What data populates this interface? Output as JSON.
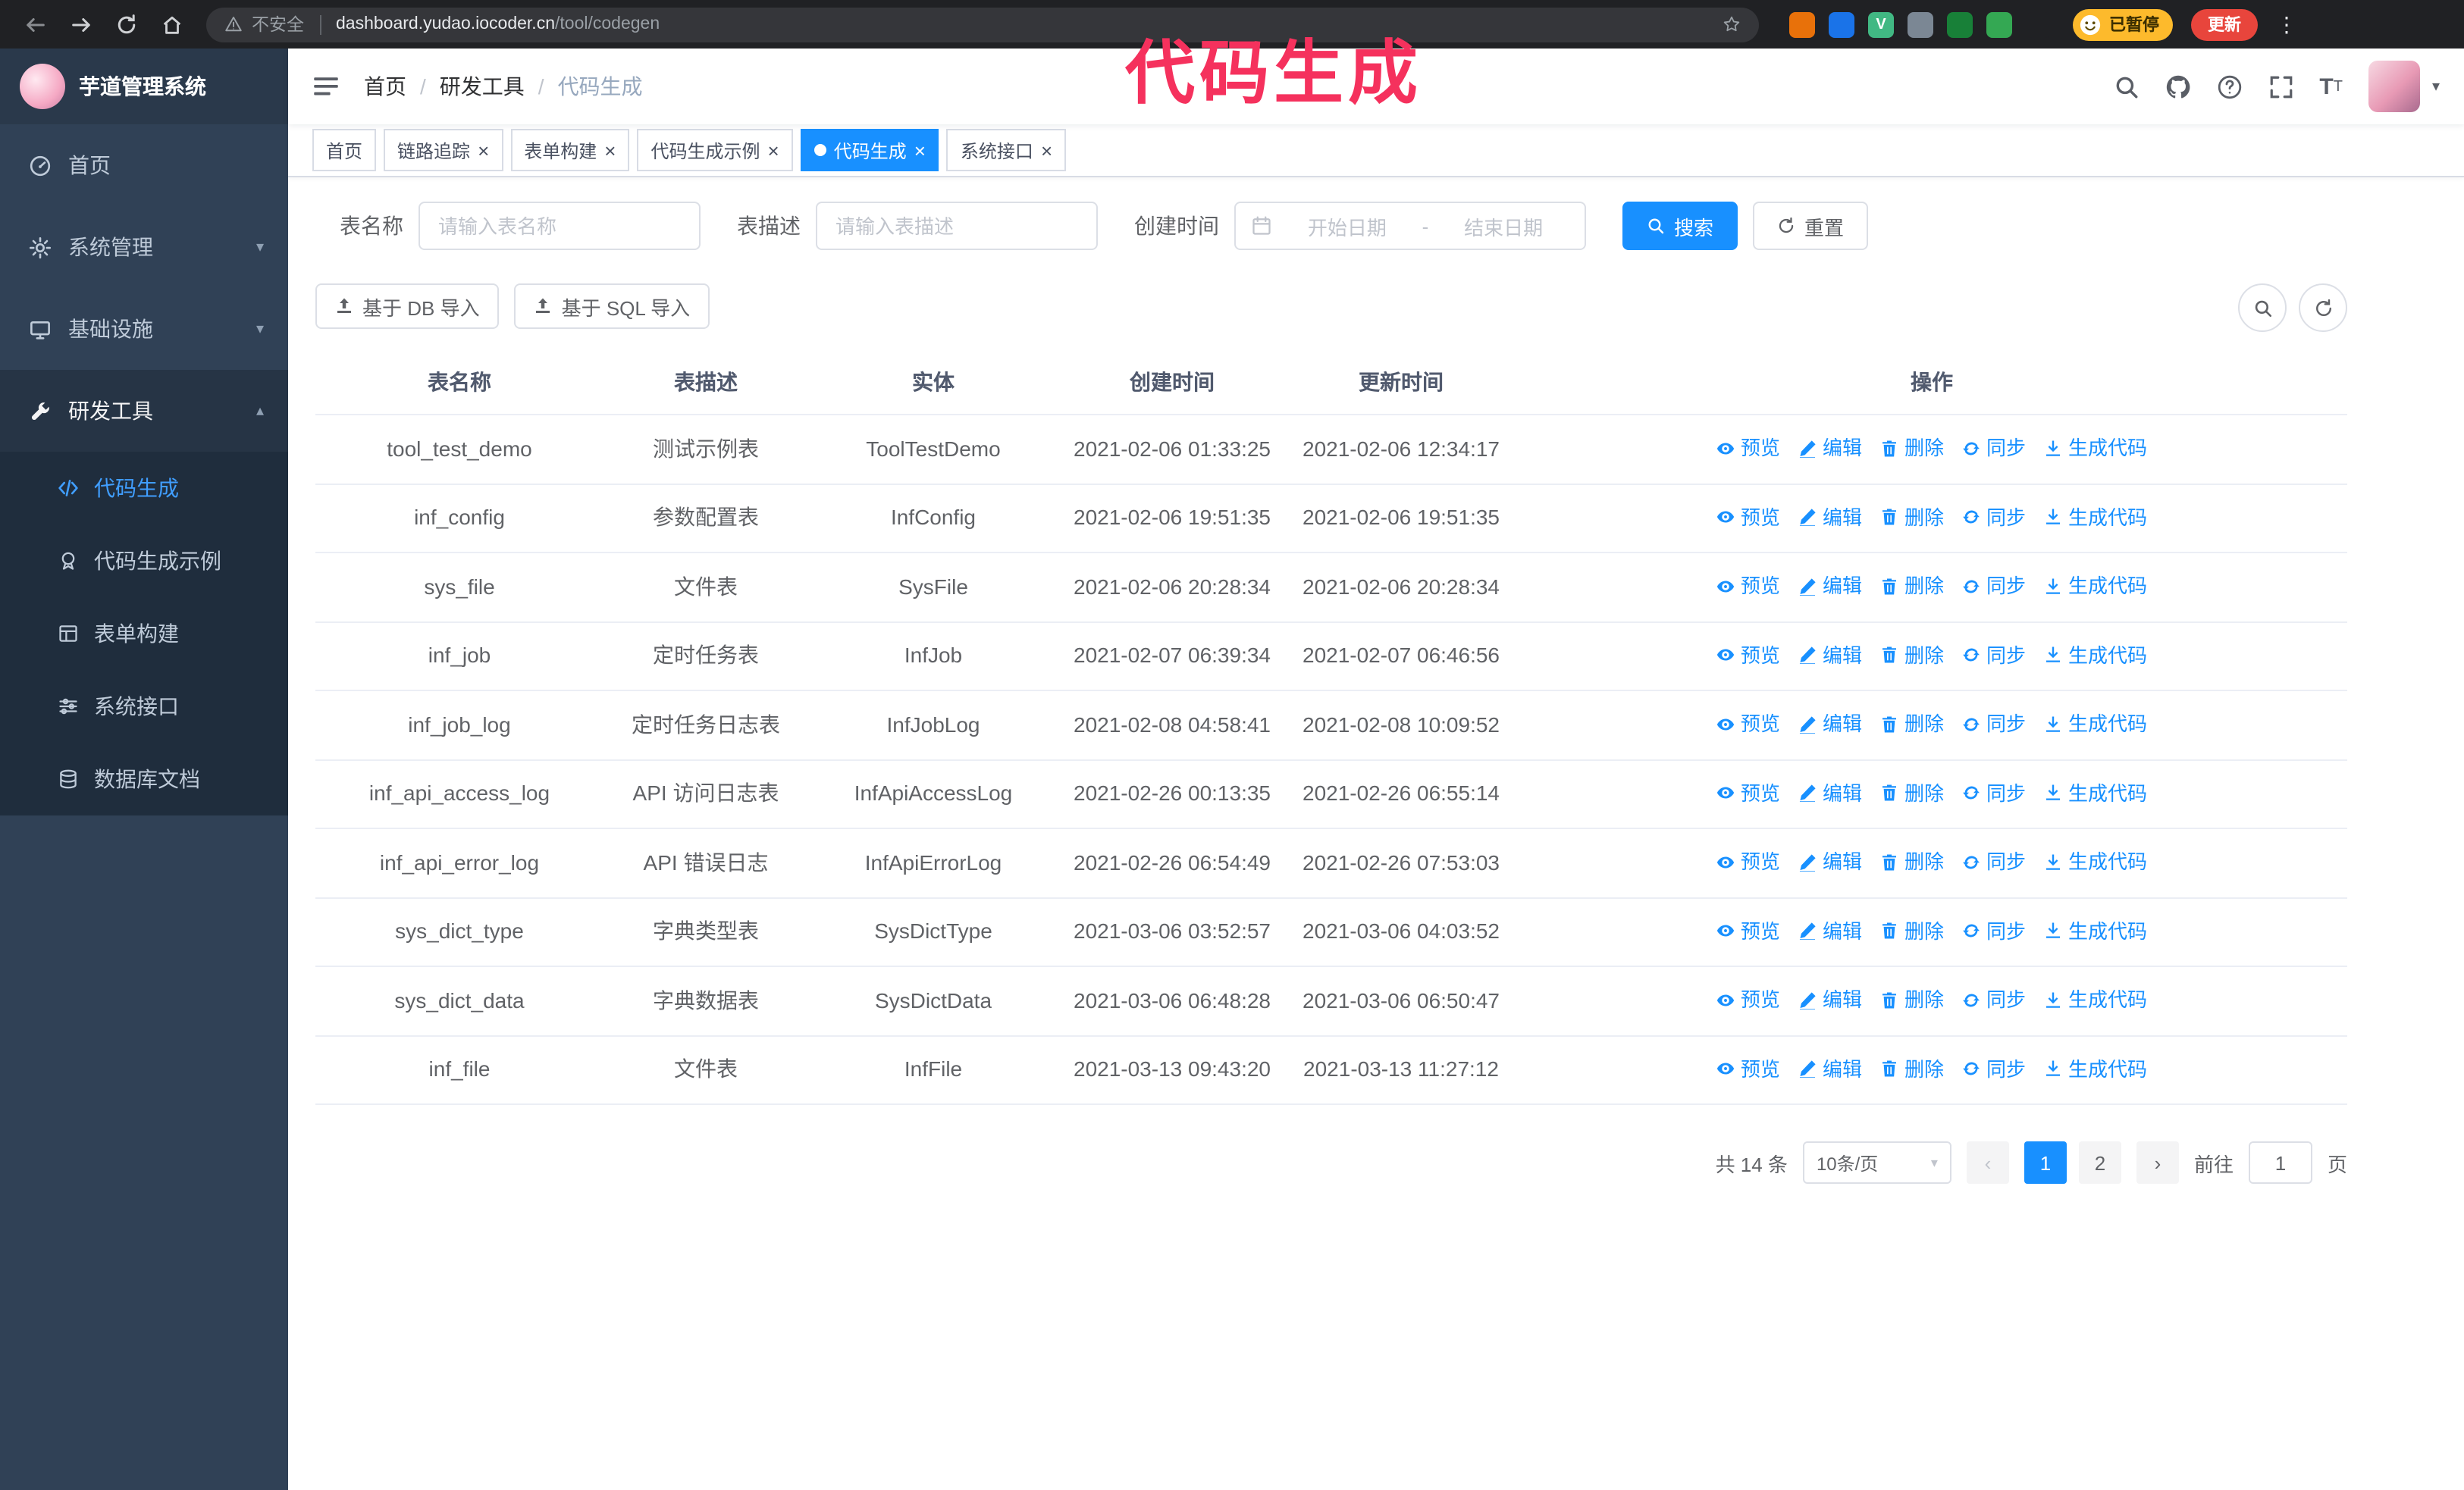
{
  "colors": {
    "accent": "#1890ff",
    "sidebar-bg": "#304156",
    "sidebar-sub-bg": "#1f2d3d",
    "sidebar-active": "#409eff",
    "annotation": "#f5315d",
    "chrome-bg": "#202124",
    "paused-bg": "#fdba2c",
    "update-bg": "#e8453c"
  },
  "browser": {
    "security_label": "不安全",
    "url_domain": "dashboard.yudao.iocoder.cn",
    "url_path": "/tool/codegen",
    "paused_badge": "已暂停",
    "update_button": "更新",
    "extensions": [
      {
        "name": "extension-orange",
        "color": "#e8710a"
      },
      {
        "name": "extension-blue",
        "color": "#1a73e8"
      },
      {
        "name": "extension-vue",
        "color": "#41b883",
        "glyph": "V"
      },
      {
        "name": "extension-people",
        "color": "#7b8794"
      },
      {
        "name": "extension-dark-green",
        "color": "#188038"
      },
      {
        "name": "extension-leaf",
        "color": "#34a853"
      },
      {
        "name": "extension-paw",
        "color": "#202124"
      }
    ]
  },
  "annotation": {
    "text": "代码生成"
  },
  "sidebar": {
    "logo_title": "芋道管理系统",
    "items": [
      {
        "label": "首页",
        "icon": "dashboard"
      },
      {
        "label": "系统管理",
        "icon": "gear",
        "chevron": "down"
      },
      {
        "label": "基础设施",
        "icon": "monitor",
        "chevron": "down"
      },
      {
        "label": "研发工具",
        "icon": "tool",
        "chevron": "up",
        "active": true
      }
    ],
    "subitems": [
      {
        "label": "代码生成",
        "icon": "code",
        "active": true
      },
      {
        "label": "代码生成示例",
        "icon": "badge"
      },
      {
        "label": "表单构建",
        "icon": "form"
      },
      {
        "label": "系统接口",
        "icon": "api"
      },
      {
        "label": "数据库文档",
        "icon": "dbdoc"
      }
    ]
  },
  "header": {
    "breadcrumb": [
      "首页",
      "研发工具",
      "代码生成"
    ]
  },
  "tabs": [
    {
      "label": "首页",
      "closable": false,
      "active": false
    },
    {
      "label": "链路追踪",
      "closable": true,
      "active": false
    },
    {
      "label": "表单构建",
      "closable": true,
      "active": false
    },
    {
      "label": "代码生成示例",
      "closable": true,
      "active": false
    },
    {
      "label": "代码生成",
      "closable": true,
      "active": true
    },
    {
      "label": "系统接口",
      "closable": true,
      "active": false
    }
  ],
  "filters": {
    "table_name_label": "表名称",
    "table_name_placeholder": "请输入表名称",
    "table_desc_label": "表描述",
    "table_desc_placeholder": "请输入表描述",
    "create_time_label": "创建时间",
    "date_start_placeholder": "开始日期",
    "date_separator": "-",
    "date_end_placeholder": "结束日期",
    "search_button": "搜索",
    "reset_button": "重置"
  },
  "toolbar": {
    "import_db_button": "基于 DB 导入",
    "import_sql_button": "基于 SQL 导入"
  },
  "table": {
    "columns": [
      "表名称",
      "表描述",
      "实体",
      "创建时间",
      "更新时间",
      "操作"
    ],
    "actions": [
      "预览",
      "编辑",
      "删除",
      "同步",
      "生成代码"
    ],
    "rows": [
      {
        "name": "tool_test_demo",
        "desc": "测试示例表",
        "entity": "ToolTestDemo",
        "created": "2021-02-06 01:33:25",
        "updated": "2021-02-06 12:34:17"
      },
      {
        "name": "inf_config",
        "desc": "参数配置表",
        "entity": "InfConfig",
        "created": "2021-02-06 19:51:35",
        "updated": "2021-02-06 19:51:35"
      },
      {
        "name": "sys_file",
        "desc": "文件表",
        "entity": "SysFile",
        "created": "2021-02-06 20:28:34",
        "updated": "2021-02-06 20:28:34"
      },
      {
        "name": "inf_job",
        "desc": "定时任务表",
        "entity": "InfJob",
        "created": "2021-02-07 06:39:34",
        "updated": "2021-02-07 06:46:56"
      },
      {
        "name": "inf_job_log",
        "desc": "定时任务日志表",
        "entity": "InfJobLog",
        "created": "2021-02-08 04:58:41",
        "updated": "2021-02-08 10:09:52"
      },
      {
        "name": "inf_api_access_log",
        "desc": "API 访问日志表",
        "entity": "InfApiAccessLog",
        "created": "2021-02-26 00:13:35",
        "updated": "2021-02-26 06:55:14"
      },
      {
        "name": "inf_api_error_log",
        "desc": "API 错误日志",
        "entity": "InfApiErrorLog",
        "created": "2021-02-26 06:54:49",
        "updated": "2021-02-26 07:53:03"
      },
      {
        "name": "sys_dict_type",
        "desc": "字典类型表",
        "entity": "SysDictType",
        "created": "2021-03-06 03:52:57",
        "updated": "2021-03-06 04:03:52"
      },
      {
        "name": "sys_dict_data",
        "desc": "字典数据表",
        "entity": "SysDictData",
        "created": "2021-03-06 06:48:28",
        "updated": "2021-03-06 06:50:47"
      },
      {
        "name": "inf_file",
        "desc": "文件表",
        "entity": "InfFile",
        "created": "2021-03-13 09:43:20",
        "updated": "2021-03-13 11:27:12"
      }
    ]
  },
  "pagination": {
    "total_label": "共 14 条",
    "page_size_label": "10条/页",
    "pages": [
      "1",
      "2"
    ],
    "active_page": "1",
    "goto_label": "前往",
    "goto_value": "1",
    "goto_unit_label": "页"
  }
}
